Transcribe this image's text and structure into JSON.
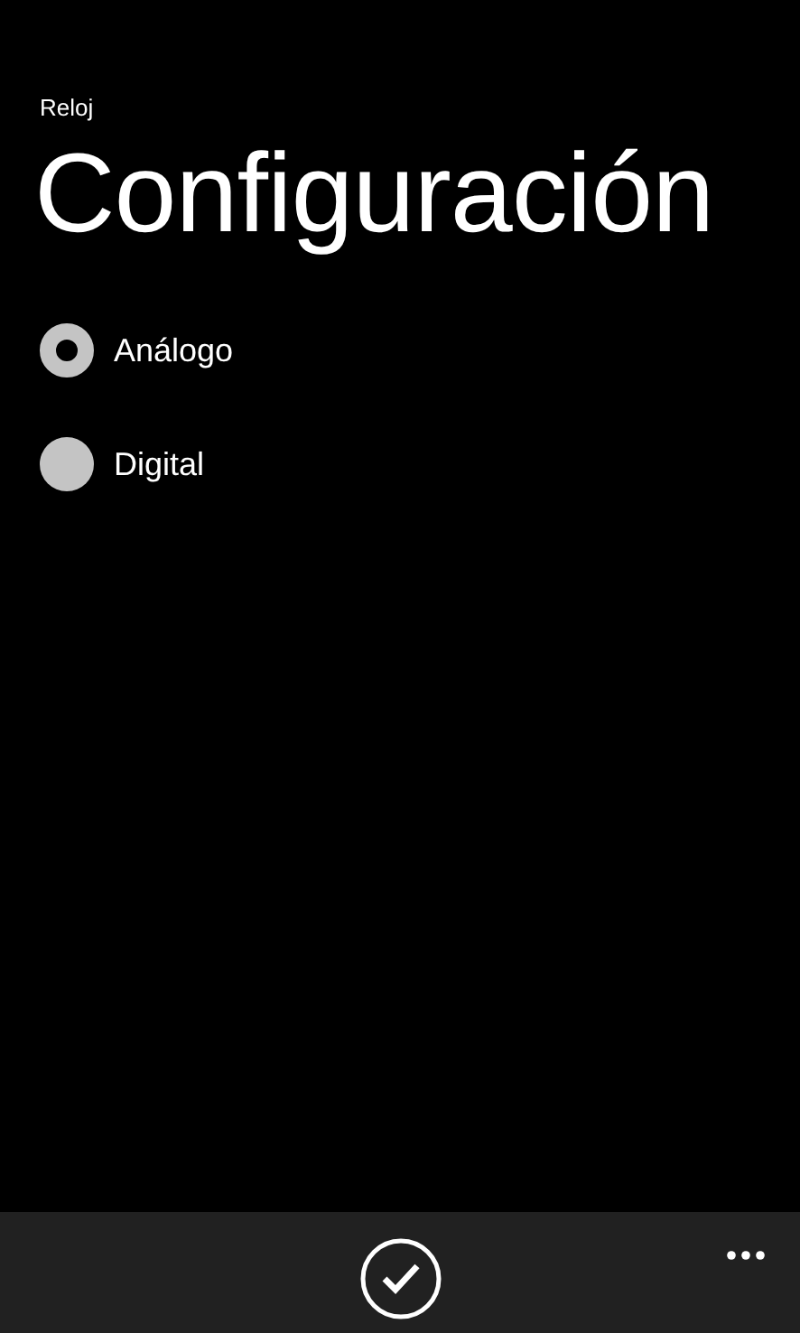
{
  "app_name": "Reloj",
  "title": "Configuración",
  "options": [
    {
      "label": "Análogo",
      "selected": true
    },
    {
      "label": "Digital",
      "selected": false
    }
  ],
  "app_bar": {
    "buttons": [
      {
        "kind": "check"
      }
    ]
  }
}
